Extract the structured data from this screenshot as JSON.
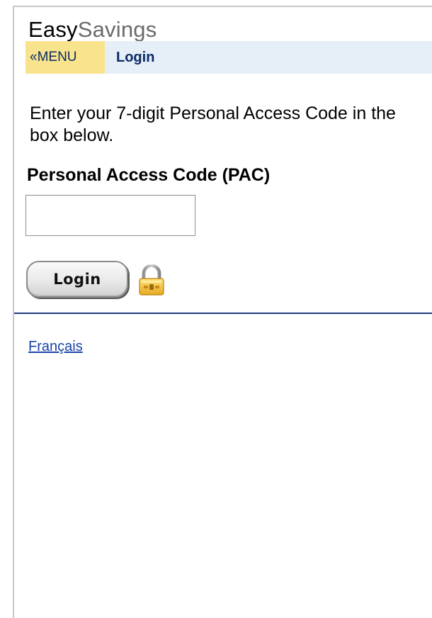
{
  "header": {
    "brand_part1": "Easy",
    "brand_part2": "Savings"
  },
  "nav": {
    "menu_label": "«MENU",
    "page_title": "Login"
  },
  "form": {
    "instructions": "Enter your 7-digit Personal Access Code in the box below.",
    "pac_label": "Personal Access Code (PAC)",
    "pac_value": "",
    "pac_placeholder": "",
    "login_button": "Login",
    "lock_icon": "padlock-icon"
  },
  "footer": {
    "language_link": "Français"
  },
  "colors": {
    "menu_bg": "#f9e48d",
    "nav_bg": "#e6eff7",
    "nav_text": "#0b2a66",
    "divider": "#1e3a78",
    "link": "#1a44a8"
  }
}
